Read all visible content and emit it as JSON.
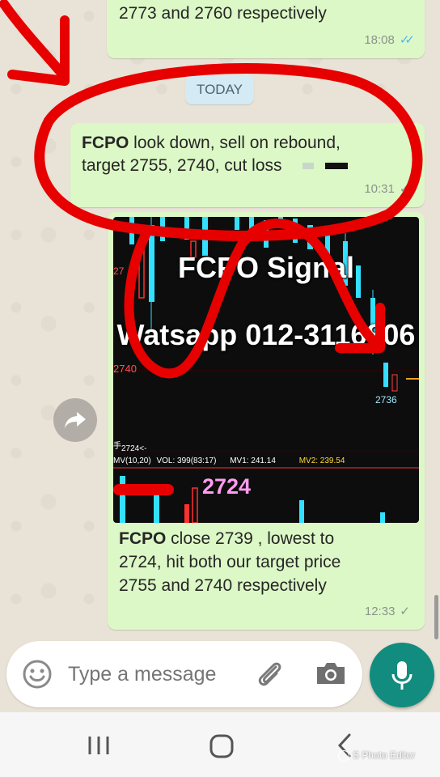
{
  "messages": [
    {
      "id": "msg-top",
      "text_line1": "2773 and 2760 respectively",
      "time": "18:08",
      "status": "read"
    },
    {
      "id": "msg-1",
      "bold": "FCPO",
      "text_line1_rest": " look down,  sell on rebound,",
      "text_line2": "target  2755, 2740, cut loss",
      "time": "10:31",
      "status": "delivered"
    },
    {
      "id": "msg-2",
      "bold": "FCPO",
      "text_line1_rest": "  close 2739 , lowest to",
      "text_line2": "2724, hit both our target price",
      "text_line3": "2755 and 2740 respectively",
      "time": "12:33",
      "status": "sent"
    }
  ],
  "date_divider": "TODAY",
  "chart_image": {
    "overlay_title": "FCPO Signal",
    "overlay_contact": "Watsapp  012-3116806",
    "label_2740": "2740",
    "label_2736": "2736",
    "label_2724_small": "2724<-",
    "label_top_27": "27",
    "label_fen": "手",
    "indicators": {
      "mv": "MV(10,20)",
      "vol": "VOL: 399(83:17)",
      "mv1": "MV1: 241.14",
      "mv2": "MV2: 239.54"
    },
    "big_low_label": "2724"
  },
  "composer": {
    "placeholder": "Type a message"
  },
  "watermark": "S Photo Editor",
  "colors": {
    "bubble": "#dcf8c6",
    "mic": "#128c7e",
    "annotation": "#e60000",
    "read_ticks": "#4fb6ec"
  },
  "icons": [
    "forward-icon",
    "emoji-icon",
    "attach-icon",
    "camera-icon",
    "mic-icon",
    "recents-icon",
    "home-icon",
    "back-icon"
  ]
}
